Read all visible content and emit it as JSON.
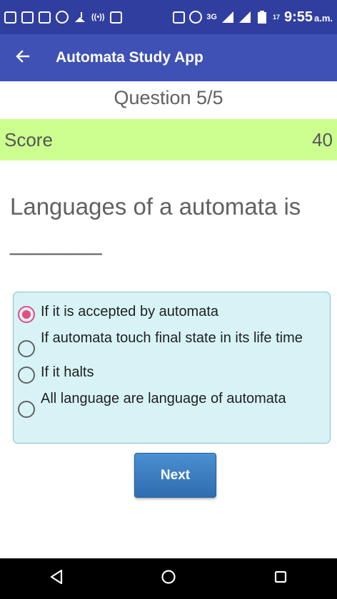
{
  "status_bar": {
    "time": "9:55",
    "ampm": "a.m.",
    "network_label": "3G",
    "battery_label": "17"
  },
  "app_bar": {
    "title": "Automata Study App"
  },
  "quiz": {
    "counter": "Question 5/5",
    "score_label": "Score",
    "score_value": "40",
    "question": "Languages of a automata is _______",
    "options": [
      {
        "label": "If it is accepted by automata",
        "selected": true
      },
      {
        "label": "If automata touch final state in its life time",
        "selected": false
      },
      {
        "label": "If it halts",
        "selected": false
      },
      {
        "label": "All language are language of automata",
        "selected": false
      }
    ],
    "next_label": "Next"
  },
  "colors": {
    "status_bar": "#303F9F",
    "app_bar": "#3F51B5",
    "score_bar": "#CCFF90",
    "options_bg": "#D7F3F6",
    "radio_accent": "#E84A7F",
    "next_button": "#2F6CB0"
  },
  "icons": {
    "back": "arrow-left-icon",
    "nav_back": "triangle-back-icon",
    "nav_home": "circle-home-icon",
    "nav_recents": "square-recents-icon"
  }
}
